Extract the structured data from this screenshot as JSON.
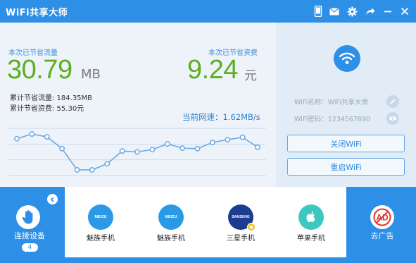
{
  "app": {
    "title": "WiFi共享大师"
  },
  "titlebar_icons": [
    "phone-icon",
    "mail-icon",
    "gear-icon",
    "share-icon",
    "minimize-icon",
    "close-icon"
  ],
  "stats": {
    "traffic_label": "本次已节省流量",
    "traffic_value": "30.79",
    "traffic_unit": "MB",
    "money_label": "本次已节省资费",
    "money_value": "9.24",
    "money_unit": "元",
    "total_traffic": "累计节省流量: 184.35MB",
    "total_money": "累计节省资费: 55.30元",
    "current_speed": "当前网速：1.62MB/s"
  },
  "chart_data": {
    "type": "line",
    "points": [
      0.78,
      0.88,
      0.82,
      0.57,
      0.12,
      0.12,
      0.25,
      0.52,
      0.5,
      0.55,
      0.67,
      0.58,
      0.57,
      0.7,
      0.76,
      0.81,
      0.6
    ],
    "ylim": [
      0,
      1
    ],
    "grid": true
  },
  "wifi_info": {
    "name_line": "WiFi名称：WiFi共享大师",
    "password_line": "WiFi密码：1234567890"
  },
  "buttons": {
    "close_wifi": "关闭WiFi",
    "restart_wifi": "重启WiFi"
  },
  "bottom": {
    "connect_label": "连接设备",
    "connect_count": "4",
    "adblock_label": "去广告",
    "adblock_text": "AD"
  },
  "devices": [
    {
      "label": "魅族手机",
      "brand": "MEIZU",
      "color": "#2b9ae6"
    },
    {
      "label": "魅族手机",
      "brand": "MEIZU",
      "color": "#2b9ae6"
    },
    {
      "label": "三星手机",
      "brand": "SAMSUNG",
      "color": "#1b3c8f"
    },
    {
      "label": "苹果手机",
      "brand": "",
      "color": "#3cc8c0"
    }
  ],
  "colors": {
    "brand_blue": "#2d8fe6",
    "green_value": "#5bb01f",
    "chart_line": "#6aa9e6",
    "ad_red": "#e2342c"
  }
}
